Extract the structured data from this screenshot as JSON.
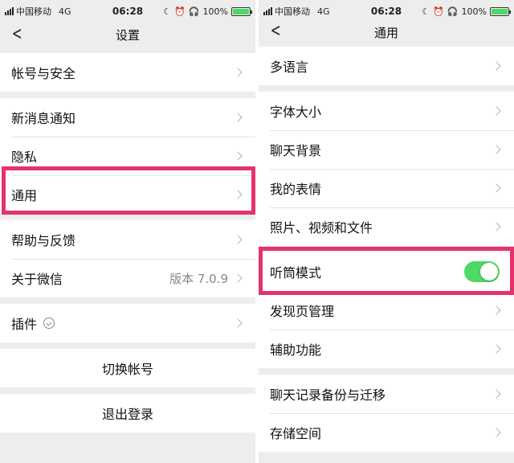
{
  "left": {
    "status": {
      "carrier": "中国移动",
      "network": "4G",
      "time": "06:28",
      "battery": "100%"
    },
    "nav": {
      "title": "设置"
    },
    "groups": [
      [
        {
          "label": "帐号与安全"
        }
      ],
      [
        {
          "label": "新消息通知"
        },
        {
          "label": "隐私"
        },
        {
          "label": "通用"
        }
      ],
      [
        {
          "label": "帮助与反馈"
        },
        {
          "label": "关于微信",
          "value": "版本 7.0.9"
        }
      ],
      [
        {
          "label": "插件"
        }
      ]
    ],
    "switch_account": "切换帐号",
    "logout": "退出登录"
  },
  "right": {
    "status": {
      "carrier": "中国移动",
      "network": "4G",
      "time": "06:28",
      "battery": "100%"
    },
    "nav": {
      "title": "通用"
    },
    "groups": [
      [
        {
          "label": "多语言"
        }
      ],
      [
        {
          "label": "字体大小"
        },
        {
          "label": "聊天背景"
        },
        {
          "label": "我的表情"
        },
        {
          "label": "照片、视频和文件"
        }
      ],
      [
        {
          "label": "听筒模式",
          "toggle": "on"
        },
        {
          "label": "发现页管理"
        },
        {
          "label": "辅助功能"
        }
      ],
      [
        {
          "label": "聊天记录备份与迁移"
        },
        {
          "label": "存储空间"
        }
      ]
    ]
  },
  "colors": {
    "highlight": "#e5336d",
    "toggle_on": "#4cd964",
    "background": "#ededed"
  },
  "icons": [
    "back-chevron-icon",
    "chevron-right-icon",
    "plugin-icon",
    "signal-icon",
    "alarm-icon",
    "headphones-icon",
    "battery-icon"
  ]
}
